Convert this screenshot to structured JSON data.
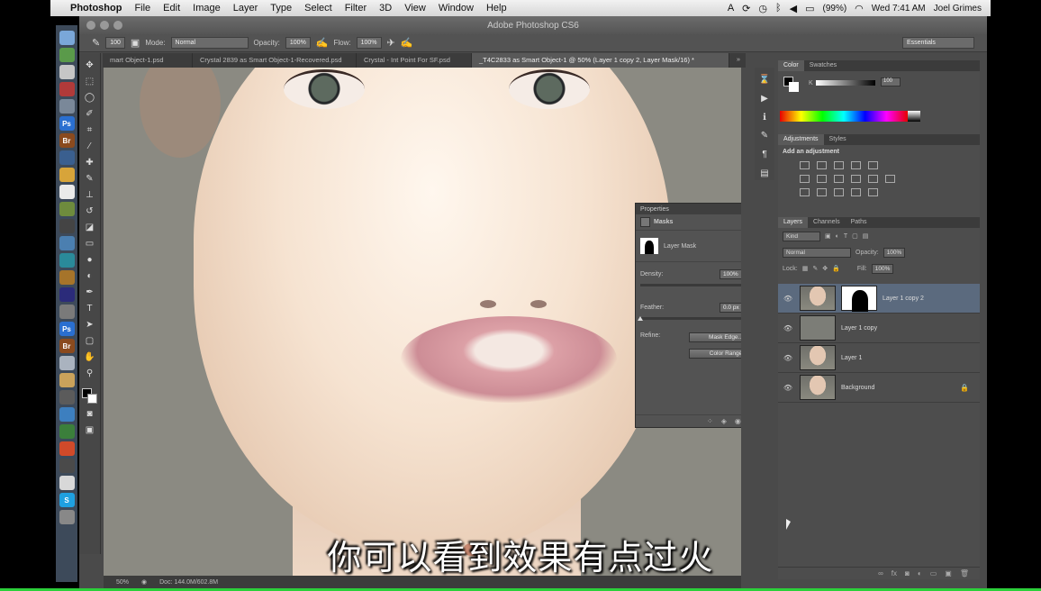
{
  "menubar": {
    "app_name": "Photoshop",
    "menus": [
      "File",
      "Edit",
      "Image",
      "Layer",
      "Type",
      "Select",
      "Filter",
      "3D",
      "View",
      "Window",
      "Help"
    ],
    "battery": "(99%)",
    "clock": "Wed 7:41 AM",
    "user": "Joel Grimes"
  },
  "window": {
    "title": "Adobe Photoshop CS6"
  },
  "options_bar": {
    "brush_size": "100",
    "mode_label": "Mode:",
    "mode_value": "Normal",
    "opacity_label": "Opacity:",
    "opacity_value": "100%",
    "flow_label": "Flow:",
    "flow_value": "100%",
    "workspace": "Essentials"
  },
  "tabs": [
    "mart Object-1.psd",
    "Crystal 2839 as Smart Object-1-Recovered.psd",
    "Crystal - Int Point For SF.psd",
    "_T4C2833 as Smart Object-1 @ 50% (Layer 1 copy 2, Layer Mask/16) *"
  ],
  "properties": {
    "tab": "Properties",
    "section": "Masks",
    "mask_type": "Layer Mask",
    "density_label": "Density:",
    "density_value": "100%",
    "density_level": 1.0,
    "feather_label": "Feather:",
    "feather_value": "0.0 px",
    "feather_level": 0.0,
    "refine_label": "Refine:",
    "mask_edge_button": "Mask Edge...",
    "color_range_button": "Color Range"
  },
  "color_panel": {
    "tabs": [
      "Color",
      "Swatches"
    ],
    "k_label": "K",
    "k_value": "100"
  },
  "adjustments": {
    "tabs": [
      "Adjustments",
      "Styles"
    ],
    "title": "Add an adjustment"
  },
  "layers_panel": {
    "tabs": [
      "Layers",
      "Channels",
      "Paths"
    ],
    "filter": "Kind",
    "blend_mode": "Normal",
    "opacity_label": "Opacity:",
    "opacity_value": "100%",
    "lock_label": "Lock:",
    "fill_label": "Fill:",
    "fill_value": "100%",
    "layers": [
      {
        "name": "Layer 1 copy 2",
        "selected": true
      },
      {
        "name": "Layer 1 copy"
      },
      {
        "name": "Layer 1"
      },
      {
        "name": "Background"
      }
    ]
  },
  "statusbar": {
    "zoom": "50%",
    "doc": "Doc: 144.0M/602.8M"
  },
  "subtitle": "你可以看到效果有点过火"
}
